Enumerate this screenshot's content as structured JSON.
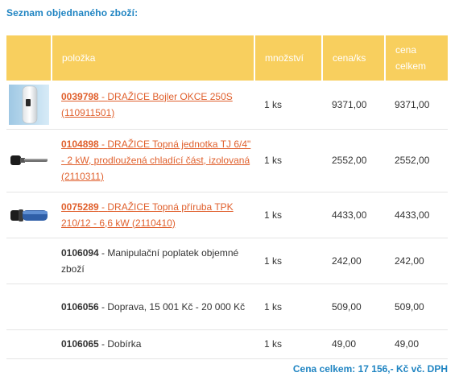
{
  "section_title": "Seznam objednaného zboží:",
  "table": {
    "headers": {
      "item": "položka",
      "qty": "množství",
      "unit_price": "cena/ks",
      "total_price_line1": "cena",
      "total_price_line2": "celkem"
    },
    "rows": [
      {
        "code": "0039798",
        "sep": " - ",
        "name": "DRAŽICE Bojler OKCE 250S (110911501)",
        "qty": "1 ks",
        "unit_price": "9371,00",
        "total": "9371,00",
        "linked": true,
        "icon": "boiler-icon"
      },
      {
        "code": "0104898",
        "sep": " - ",
        "name": "DRAŽICE Topná jednotka TJ 6/4\" - 2 kW, prodloužená chladící část, izolovaná (2110311)",
        "qty": "1 ks",
        "unit_price": "2552,00",
        "total": "2552,00",
        "linked": true,
        "icon": "heating-element-icon"
      },
      {
        "code": "0075289",
        "sep": " - ",
        "name": "DRAŽICE Topná příruba TPK 210/12 - 6,6 kW (2110410)",
        "qty": "1 ks",
        "unit_price": "4433,00",
        "total": "4433,00",
        "linked": true,
        "icon": "heating-flange-icon"
      },
      {
        "code": "0106094",
        "sep": " - ",
        "name": "Manipulační poplatek objemné zboží",
        "qty": "1 ks",
        "unit_price": "242,00",
        "total": "242,00",
        "linked": false
      },
      {
        "code": "0106056",
        "sep": " - ",
        "name": "Doprava, 15 001 Kč - 20 000 Kč",
        "qty": "1 ks",
        "unit_price": "509,00",
        "total": "509,00",
        "linked": false
      },
      {
        "code": "0106065",
        "sep": " - ",
        "name": "Dobírka",
        "qty": "1 ks",
        "unit_price": "49,00",
        "total": "49,00",
        "linked": false
      }
    ]
  },
  "total_text": "Cena celkem: 17 156,- Kč vč. DPH",
  "colors": {
    "accent": "#1f84c2",
    "header_bg": "#f8cf5e",
    "link": "#e0602d"
  }
}
